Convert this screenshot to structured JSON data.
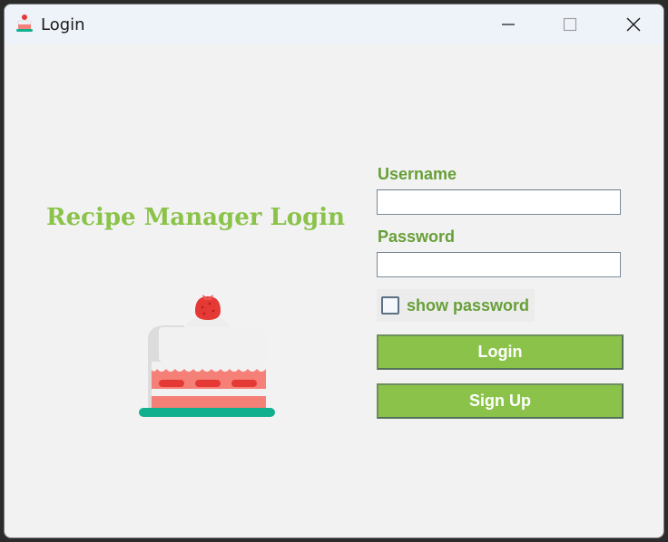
{
  "window": {
    "title": "Login"
  },
  "title_buttons": {
    "minimize": "minimize-icon",
    "maximize": "maximize-icon",
    "close": "close-icon"
  },
  "brand": {
    "heading": "Recipe Manager Login",
    "illustration": "cake-icon"
  },
  "form": {
    "username_label": "Username",
    "username_value": "",
    "password_label": "Password",
    "password_value": "",
    "show_password_label": "show password",
    "show_password_checked": false,
    "login_label": "Login",
    "signup_label": "Sign Up"
  },
  "colors": {
    "accent": "#8bc34a",
    "label_green": "#689f38",
    "window_bg": "#f2f2f2",
    "titlebar_bg": "#eef3f9"
  }
}
